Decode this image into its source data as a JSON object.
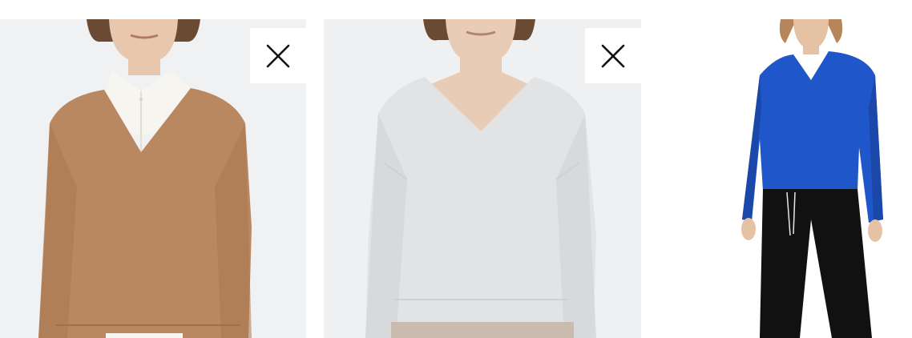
{
  "products": [
    {
      "name": "product-card-caramel",
      "image_icon": "sweater-photo",
      "sweater_color": "#b98760",
      "removable": true,
      "remove_icon": "close-icon"
    },
    {
      "name": "product-card-offwhite",
      "image_icon": "sweater-photo",
      "sweater_color": "#e2e3e5",
      "removable": true,
      "remove_icon": "close-icon"
    },
    {
      "name": "product-card-blue",
      "image_icon": "sweater-photo",
      "sweater_color": "#1f56c9",
      "removable": false
    }
  ]
}
